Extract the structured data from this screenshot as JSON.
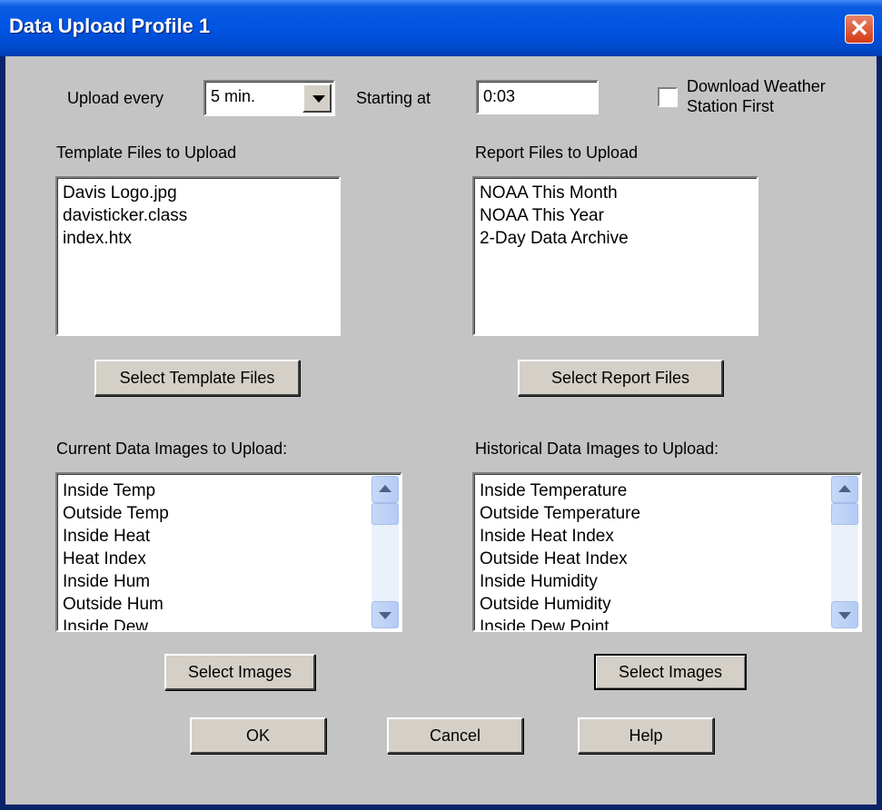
{
  "window": {
    "title": "Data Upload Profile 1",
    "close_glyph": "✕"
  },
  "schedule": {
    "upload_every_label": "Upload every",
    "upload_every_value": "5 min.",
    "starting_at_label": "Starting at",
    "starting_at_value": "0:03",
    "download_first_label_line1": "Download Weather",
    "download_first_label_line2": "Station First",
    "download_first_checked": false
  },
  "template_files": {
    "label": "Template Files to Upload",
    "items": [
      "Davis Logo.jpg",
      "davisticker.class",
      "index.htx"
    ],
    "button": "Select Template Files"
  },
  "report_files": {
    "label": "Report Files to Upload",
    "items": [
      "NOAA This Month",
      "NOAA This Year",
      "2-Day Data Archive"
    ],
    "button": "Select Report Files"
  },
  "current_images": {
    "label": "Current Data Images to Upload:",
    "items": [
      "Inside Temp",
      "Outside Temp",
      "Inside Heat",
      "Heat Index",
      "Inside Hum",
      "Outside Hum",
      "Inside Dew"
    ],
    "button": "Select Images"
  },
  "historical_images": {
    "label": "Historical Data Images to Upload:",
    "items": [
      "Inside Temperature",
      "Outside Temperature",
      "Inside Heat Index",
      "Outside Heat Index",
      "Inside Humidity",
      "Outside Humidity",
      "Inside Dew Point"
    ],
    "button": "Select Images"
  },
  "footer": {
    "ok": "OK",
    "cancel": "Cancel",
    "help": "Help"
  }
}
